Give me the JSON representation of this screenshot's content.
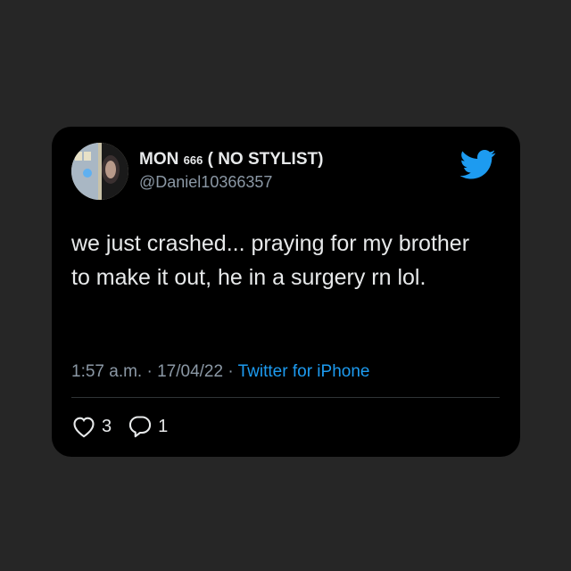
{
  "tweet": {
    "display_name": "MON",
    "name_superscript": "666",
    "name_suffix": "( NO STYLIST)",
    "handle": "@Daniel10366357",
    "text": "we just crashed... praying for my brother to make it out, he in a surgery rn lol.",
    "time": "1:57 a.m.",
    "separator": "·",
    "date": "17/04/22",
    "source": "Twitter for iPhone",
    "likes": "3",
    "replies": "1"
  },
  "icons": {
    "brand": "twitter-bird-icon",
    "like": "heart-icon",
    "reply": "reply-bubble-icon"
  },
  "colors": {
    "background": "#262626",
    "card": "#000000",
    "accent": "#1d9bf0",
    "secondary_text": "#8b98a5",
    "primary_text": "#e7e9ea"
  }
}
